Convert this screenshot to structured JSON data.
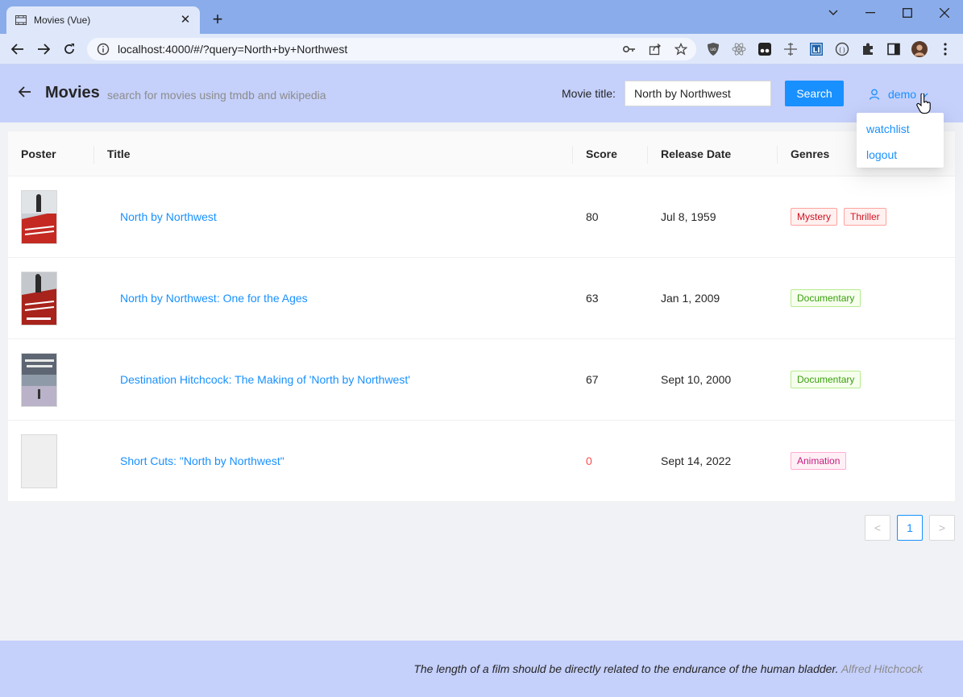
{
  "browser": {
    "tab_title": "Movies (Vue)",
    "url": "localhost:4000/#/?query=North+by+Northwest"
  },
  "header": {
    "title": "Movies",
    "subtitle": "search for movies using tmdb and wikipedia",
    "search_label": "Movie title",
    "search_value": "North by Northwest",
    "search_button": "Search",
    "user": "demo"
  },
  "user_menu": {
    "items": [
      "watchlist",
      "logout"
    ]
  },
  "table": {
    "columns": [
      "Poster",
      "Title",
      "Score",
      "Release Date",
      "Genres"
    ],
    "rows": [
      {
        "title": "North by Northwest",
        "score": "80",
        "release_date": "Jul 8, 1959",
        "genres": [
          {
            "label": "Mystery",
            "color": "red"
          },
          {
            "label": "Thriller",
            "color": "red"
          }
        ],
        "poster": "red"
      },
      {
        "title": "North by Northwest: One for the Ages",
        "score": "63",
        "release_date": "Jan 1, 2009",
        "genres": [
          {
            "label": "Documentary",
            "color": "green"
          }
        ],
        "poster": "dark-red"
      },
      {
        "title": "Destination Hitchcock: The Making of 'North by Northwest'",
        "score": "67",
        "release_date": "Sept 10, 2000",
        "genres": [
          {
            "label": "Documentary",
            "color": "green"
          }
        ],
        "poster": "grey-blue"
      },
      {
        "title": "Short Cuts: \"North by Northwest\"",
        "score": "0",
        "release_date": "Sept 14, 2022",
        "genres": [
          {
            "label": "Animation",
            "color": "magenta"
          }
        ],
        "poster": "none"
      }
    ]
  },
  "pagination": {
    "prev": "<",
    "current": "1",
    "next": ">"
  },
  "footer": {
    "quote": "The length of a film should be directly related to the endurance of the human bladder.",
    "author": "Alfred Hitchcock"
  },
  "colors": {
    "header_bg": "#c5d0fb",
    "accent": "#1890ff",
    "chrome_tabbar": "#8aacea",
    "chrome_toolbar": "#dfe8fb"
  }
}
